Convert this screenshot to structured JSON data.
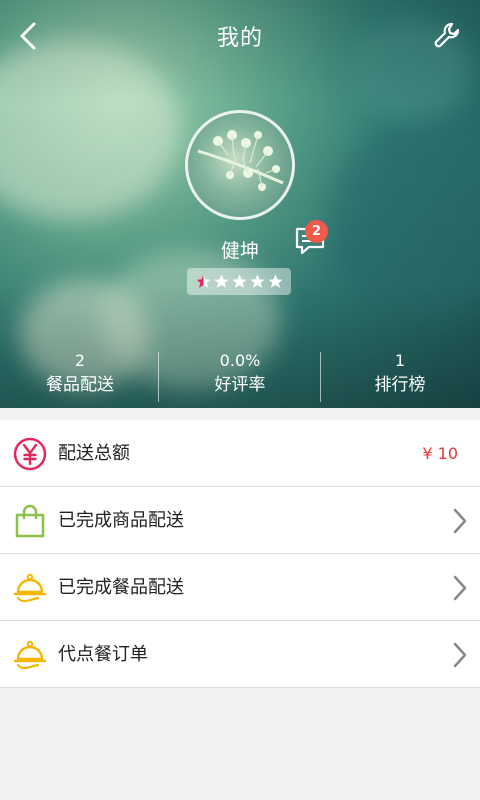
{
  "header": {
    "title": "我的"
  },
  "profile": {
    "name": "健坤",
    "message_count": "2",
    "rating_stars": 0.5,
    "rating_max": 5
  },
  "stats": [
    {
      "value": "2",
      "label": "餐品配送"
    },
    {
      "value": "0.0%",
      "label": "好评率"
    },
    {
      "value": "1",
      "label": "排行榜"
    }
  ],
  "menu": {
    "total_delivery": {
      "label": "配送总额",
      "amount": "¥ 10"
    },
    "goods_done": {
      "label": "已完成商品配送"
    },
    "meals_done": {
      "label": "已完成餐品配送"
    },
    "proxy_orders": {
      "label": "代点餐订单"
    }
  },
  "colors": {
    "accent_red": "#e5285a",
    "green": "#8bc34a",
    "gold": "#f2b705",
    "badge": "#f05a4a"
  }
}
